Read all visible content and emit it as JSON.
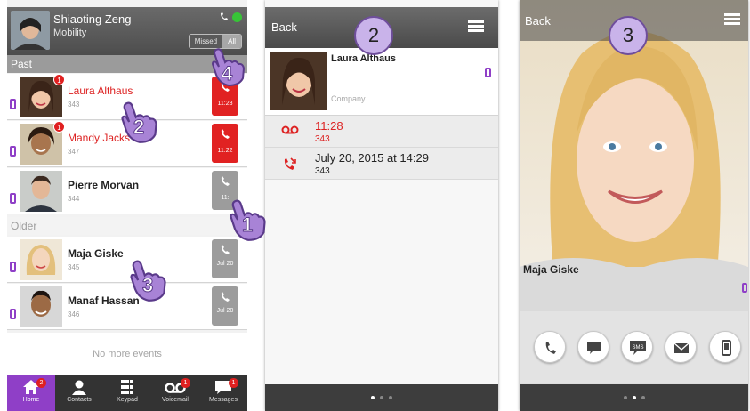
{
  "panel1": {
    "user_name": "Shiaoting Zeng",
    "user_role": "Mobility",
    "filter": {
      "missed": "Missed",
      "all": "All"
    },
    "section_past": "Past",
    "section_older": "Older",
    "calls": [
      {
        "name": "Laura Althaus",
        "number": "343",
        "time": "11:28",
        "missed": true,
        "badge": "1"
      },
      {
        "name": "Mandy Jacks",
        "number": "347",
        "time": "11:22",
        "missed": true,
        "badge": "1"
      },
      {
        "name": "Pierre Morvan",
        "number": "344",
        "time": "11:",
        "missed": false,
        "badge": ""
      },
      {
        "name": "Maja Giske",
        "number": "345",
        "time": "Jul 20",
        "missed": false,
        "badge": ""
      },
      {
        "name": "Manaf Hassan",
        "number": "346",
        "time": "Jul 20",
        "missed": false,
        "badge": ""
      }
    ],
    "no_more": "No more events",
    "tabs": [
      {
        "label": "Home",
        "badge": "2",
        "icon": "home-icon"
      },
      {
        "label": "Contacts",
        "badge": "",
        "icon": "contacts-icon"
      },
      {
        "label": "Keypad",
        "badge": "",
        "icon": "keypad-icon"
      },
      {
        "label": "Voicemail",
        "badge": "1",
        "icon": "voicemail-icon"
      },
      {
        "label": "Messages",
        "badge": "1",
        "icon": "messages-icon"
      }
    ]
  },
  "panel2": {
    "back": "Back",
    "contact_name": "Laura Althaus",
    "company": "Company",
    "history": [
      {
        "line1": "11:28",
        "line2": "343",
        "icon": "voicemail-icon",
        "color": "#dd2222"
      },
      {
        "line1": "July 20, 2015 at 14:29",
        "line2": "343",
        "icon": "missed-call-icon",
        "color": "#222222"
      }
    ]
  },
  "panel3": {
    "back": "Back",
    "contact_name": "Maja Giske",
    "actions": [
      "call-icon",
      "chat-icon",
      "sms-icon",
      "email-icon",
      "mobile-icon"
    ],
    "sms_label": "SMS"
  },
  "steps": [
    "1",
    "2",
    "3",
    "4"
  ],
  "colors": {
    "accent": "#8f3fc7",
    "missed": "#dd2222",
    "callout": "#c9b3ea"
  }
}
